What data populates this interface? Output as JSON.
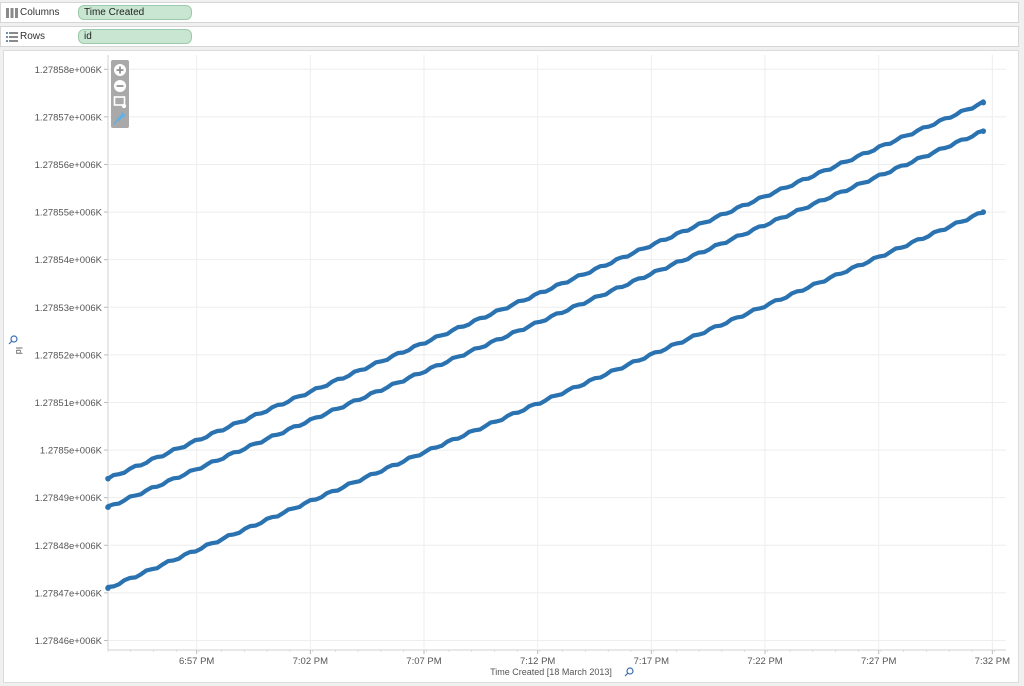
{
  "shelves": {
    "columns": {
      "label": "Columns",
      "pill": "Time Created"
    },
    "rows": {
      "label": "Rows",
      "pill": "id"
    }
  },
  "toolbar": {
    "zoom_in": "zoom-in-icon",
    "zoom_out": "zoom-out-icon",
    "select": "rect-select-icon",
    "pin": "pin-icon"
  },
  "colors": {
    "mark": "#2a73b0",
    "grid": "#eeeeee",
    "pill_fill": "#c8e6d2"
  },
  "chart_data": {
    "type": "line",
    "xlabel": "Time Created [18 March 2013]",
    "ylabel": "Id",
    "x_ticks": [
      "6:57 PM",
      "7:02 PM",
      "7:07 PM",
      "7:12 PM",
      "7:17 PM",
      "7:22 PM",
      "7:27 PM",
      "7:32 PM"
    ],
    "y_ticks": [
      "1.27858e+006K",
      "1.27857e+006K",
      "1.27856e+006K",
      "1.27855e+006K",
      "1.27854e+006K",
      "1.27853e+006K",
      "1.27852e+006K",
      "1.27851e+006K",
      "1.2785e+006K",
      "1.27849e+006K",
      "1.27848e+006K",
      "1.27847e+006K",
      "1.27846e+006K"
    ],
    "y_values": [
      1278580,
      1278570,
      1278560,
      1278550,
      1278540,
      1278530,
      1278520,
      1278510,
      1278500,
      1278490,
      1278480,
      1278470,
      1278460
    ],
    "x_range_minutes": [
      0,
      39.5
    ],
    "y_range": [
      1278458,
      1278583
    ],
    "x_tick_minutes": [
      3.9,
      8.9,
      13.9,
      18.9,
      23.9,
      28.9,
      33.9,
      38.9
    ],
    "grid": true,
    "series": [
      {
        "x": [
          0,
          38.5
        ],
        "y": [
          1278494,
          1278573
        ]
      },
      {
        "x": [
          0,
          38.5
        ],
        "y": [
          1278488,
          1278567
        ]
      },
      {
        "x": [
          0,
          38.5
        ],
        "y": [
          1278471,
          1278550
        ]
      }
    ]
  }
}
